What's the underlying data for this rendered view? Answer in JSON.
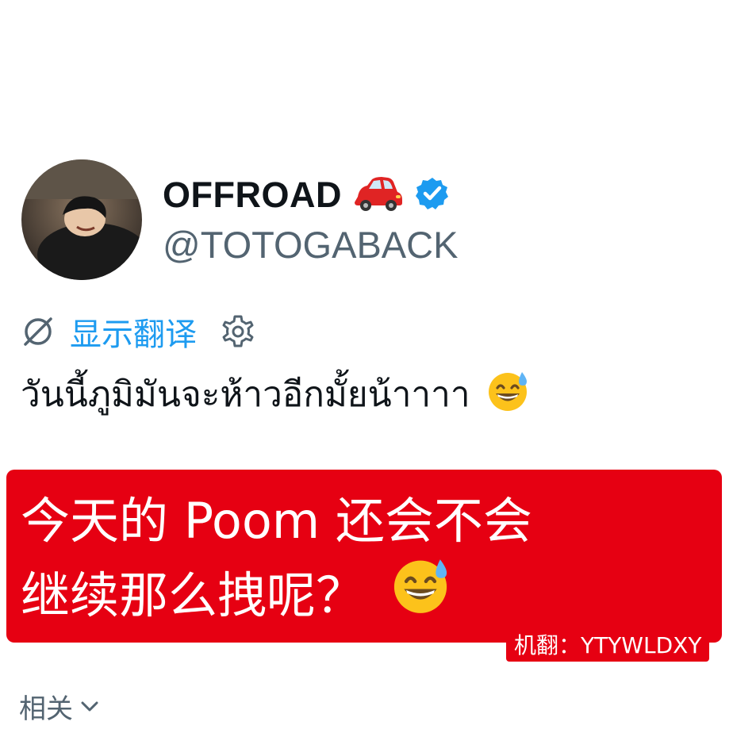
{
  "profile": {
    "display_name": "OFFROAD",
    "handle": "@TOTOGABACK",
    "name_emoji": "car-icon",
    "verified": true
  },
  "translate": {
    "link_label": "显示翻译",
    "icons": [
      "globe-icon",
      "gear-icon"
    ]
  },
  "tweet": {
    "text": "วันนี้ภูมิมันจะห้าวอีกมั้ยน้าาาา",
    "trailing_emoji": "sweat-smile-emoji"
  },
  "overlay": {
    "line1": "今天的 Poom 还会不会",
    "line2": "继续那么拽呢？",
    "badge": "机翻：YTYWLDXY",
    "color": "#e60012"
  },
  "related": {
    "label": "相关"
  },
  "colors": {
    "link": "#1d9bf0",
    "verified": "#1d9bf0",
    "secondary_text": "#536471"
  }
}
